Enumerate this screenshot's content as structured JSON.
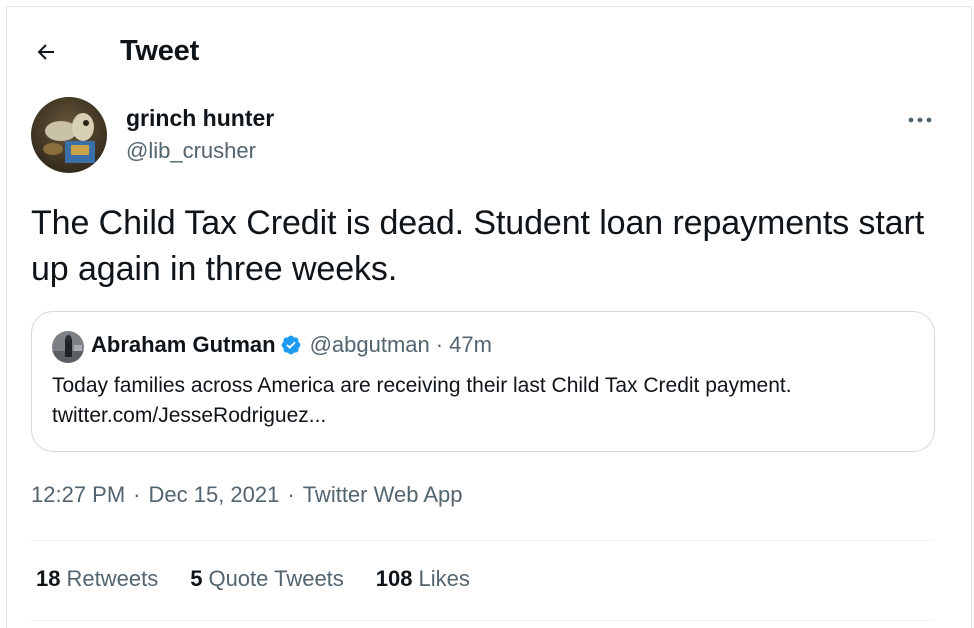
{
  "header": {
    "title": "Tweet",
    "back_icon": "arrow-left-icon"
  },
  "author": {
    "name": "grinch hunter",
    "handle": "@lib_crusher",
    "avatar_icon": "avatar-image"
  },
  "tweet": {
    "text": "The Child Tax Credit is dead. Student loan repayments start up again in three weeks.",
    "more_icon": "more-options-icon"
  },
  "quote": {
    "name": "Abraham Gutman",
    "verified": true,
    "handle": "@abgutman",
    "separator": "·",
    "time": "47m",
    "text_line1": "Today families across America are receiving their last Child Tax Credit payment.",
    "text_line2": "twitter.com/JesseRodriguez..."
  },
  "meta": {
    "time": "12:27 PM",
    "sep1": "·",
    "date": "Dec 15, 2021",
    "sep2": "·",
    "source": "Twitter Web App"
  },
  "stats": [
    {
      "count": "18",
      "label": "Retweets"
    },
    {
      "count": "5",
      "label": "Quote Tweets"
    },
    {
      "count": "108",
      "label": "Likes"
    }
  ],
  "colors": {
    "text_primary": "#0f1419",
    "text_secondary": "#536471",
    "border": "#cfd9de",
    "divider": "#eff3f4",
    "verified_blue": "#1d9bf0"
  }
}
